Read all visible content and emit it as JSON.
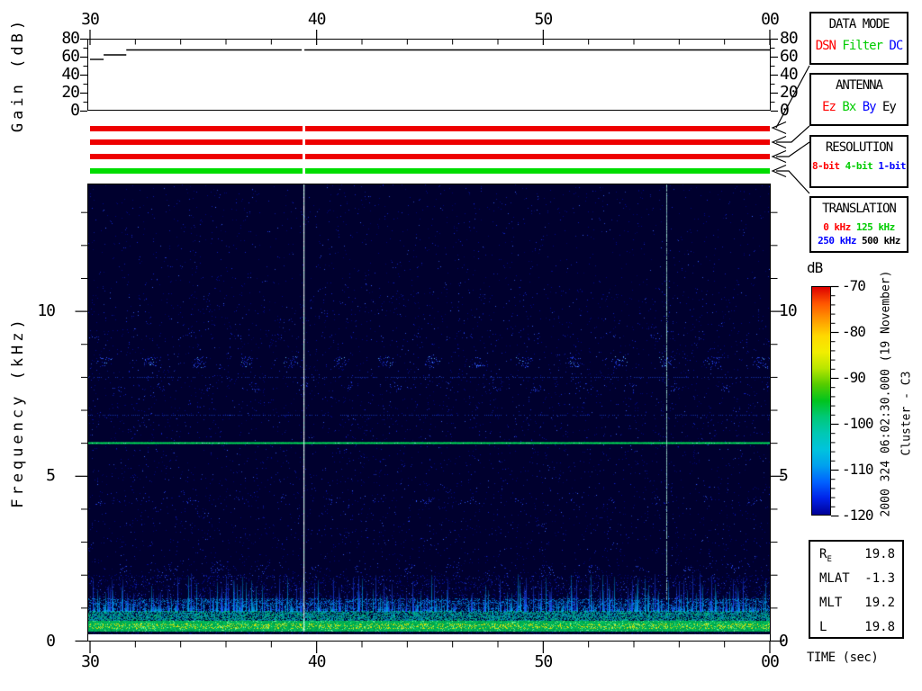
{
  "gain_panel": {
    "ylabel": "Gain (dB)",
    "y_major_ticks": [
      "80",
      "60",
      "40",
      "20",
      "0"
    ],
    "y_major_values": [
      80,
      60,
      40,
      20,
      0
    ],
    "top_time_tick_labels": [
      "30",
      "40",
      "50",
      "00"
    ],
    "top_time_tick_seconds": [
      30,
      40,
      50,
      60
    ]
  },
  "spectrogram_panel": {
    "ylabel": "Frequency (kHz)",
    "y_major_ticks": [
      "10",
      "5",
      "0"
    ],
    "y_major_values": [
      10,
      5,
      0
    ],
    "bottom_time_tick_labels": [
      "30",
      "40",
      "50",
      "00"
    ],
    "bottom_time_tick_seconds": [
      30,
      40,
      50,
      60
    ],
    "xlabel": "TIME (sec)"
  },
  "status_bars": [
    {
      "channel": "DATA MODE",
      "color": "#ee0000"
    },
    {
      "channel": "ANTENNA",
      "color": "#ee0000"
    },
    {
      "channel": "RESOLUTION",
      "color": "#ee0000"
    },
    {
      "channel": "TRANSLATION",
      "color": "#00dd00"
    }
  ],
  "legend_boxes": [
    {
      "id": "data-mode",
      "title": "DATA MODE",
      "small": false,
      "rows": [
        [
          {
            "label": "DSN",
            "color": "#ff0000"
          },
          {
            "label": "Filter",
            "color": "#00cc00"
          },
          {
            "label": "DC",
            "color": "#0000ff"
          }
        ]
      ]
    },
    {
      "id": "antenna",
      "title": "ANTENNA",
      "small": false,
      "rows": [
        [
          {
            "label": "Ez",
            "color": "#ff0000"
          },
          {
            "label": "Bx",
            "color": "#00cc00"
          },
          {
            "label": "By",
            "color": "#0000ff"
          },
          {
            "label": "Ey",
            "color": "#000000"
          }
        ]
      ]
    },
    {
      "id": "resolution",
      "title": "RESOLUTION",
      "small": true,
      "rows": [
        [
          {
            "label": "8-bit",
            "color": "#ff0000"
          },
          {
            "label": "4-bit",
            "color": "#00cc00"
          },
          {
            "label": "1-bit",
            "color": "#0000ff"
          }
        ]
      ]
    },
    {
      "id": "translation",
      "title": "TRANSLATION",
      "small": true,
      "rows": [
        [
          {
            "label": "0 kHz",
            "color": "#ff0000"
          },
          {
            "label": "125 kHz",
            "color": "#00cc00"
          }
        ],
        [
          {
            "label": "250 kHz",
            "color": "#0000ff"
          },
          {
            "label": "500 kHz",
            "color": "#000000"
          }
        ]
      ]
    }
  ],
  "colorbar": {
    "title": "dB",
    "tick_labels": [
      "-70",
      "-80",
      "-90",
      "-100",
      "-110",
      "-120"
    ],
    "tick_values": [
      -70,
      -80,
      -90,
      -100,
      -110,
      -120
    ],
    "gradient_top_to_bottom": [
      "#dd0000",
      "#ff5500",
      "#ff9900",
      "#ffd800",
      "#f2ee00",
      "#b8e600",
      "#55cc00",
      "#00c41e",
      "#00c878",
      "#00c8b4",
      "#00c3dd",
      "#009fee",
      "#0061ff",
      "#0022e8",
      "#000096"
    ]
  },
  "side_text": {
    "datetime": "2000 324 06:02:30.000 (19 November)",
    "spacecraft": "Cluster - C3"
  },
  "ephemeris": {
    "rows": [
      {
        "label": "R",
        "sub": "E",
        "value": "19.8"
      },
      {
        "label": "MLAT",
        "sub": "",
        "value": "-1.3"
      },
      {
        "label": "MLT",
        "sub": "",
        "value": "19.2"
      },
      {
        "label": "L",
        "sub": "",
        "value": "19.8"
      }
    ]
  },
  "time_axis_label": "TIME (sec)",
  "chart_data": [
    {
      "type": "line",
      "title": "Receiver gain vs time",
      "ylabel": "Gain (dB)",
      "xlabel": "TIME (sec)",
      "ylim": [
        0,
        80
      ],
      "yticks": [
        0,
        20,
        40,
        60,
        80
      ],
      "x_range_sec": [
        30,
        60
      ],
      "xticks": [
        "30",
        "40",
        "50",
        "00"
      ],
      "grid": false,
      "series": [
        {
          "name": "gain",
          "step_segments": [
            {
              "t_start": 30.0,
              "t_end": 30.6,
              "gain_db": 57
            },
            {
              "t_start": 30.6,
              "t_end": 31.6,
              "gain_db": 62
            },
            {
              "t_start": 31.6,
              "t_end": 60.0,
              "gain_db": 67.5
            }
          ],
          "gap_at_sec": 39.4
        }
      ]
    },
    {
      "type": "heatmap",
      "title": "Cluster C3 WBD wideband spectrogram",
      "xlabel": "TIME (sec)",
      "ylabel": "Frequency (kHz)",
      "zlabel": "dB",
      "x_range_sec": [
        30,
        60
      ],
      "ylim_khz": [
        0,
        13.8
      ],
      "zlim_db": [
        -120,
        -70
      ],
      "colormap": "rainbow",
      "xtick_seconds": [
        30,
        40,
        50,
        60
      ],
      "ytick_khz": [
        0,
        5,
        10
      ],
      "background_level_db": -120,
      "features": [
        {
          "name": "persistent narrowband tone",
          "freq_khz": 6.0,
          "level_db": -88,
          "extent": "full 30 s"
        },
        {
          "name": "intense low-frequency band",
          "freq_khz_range": [
            0.3,
            0.7
          ],
          "level_db": -78,
          "extent": "full 30 s, green-yellow"
        },
        {
          "name": "impulsive vertical bursts",
          "freq_khz_range": [
            0.7,
            1.9
          ],
          "level_db": -100,
          "extent": "quasi-periodic, full 30 s"
        },
        {
          "name": "weak interference band",
          "freq_khz": 8.45,
          "level_db": -110,
          "extent": "clumps every ~2 s"
        },
        {
          "name": "weak interference bands",
          "freq_khz_list": [
            9.25,
            7.7,
            4.25,
            2.2
          ],
          "level_db": -113,
          "extent": "intermittent"
        },
        {
          "name": "data gap / marker line",
          "time_sec": 39.4,
          "appearance": "white vertical line, also gaps status bars and gain trace"
        },
        {
          "name": "broadband burst",
          "time_sec": 55.4,
          "appearance": "pale cyan vertical line"
        }
      ]
    }
  ]
}
